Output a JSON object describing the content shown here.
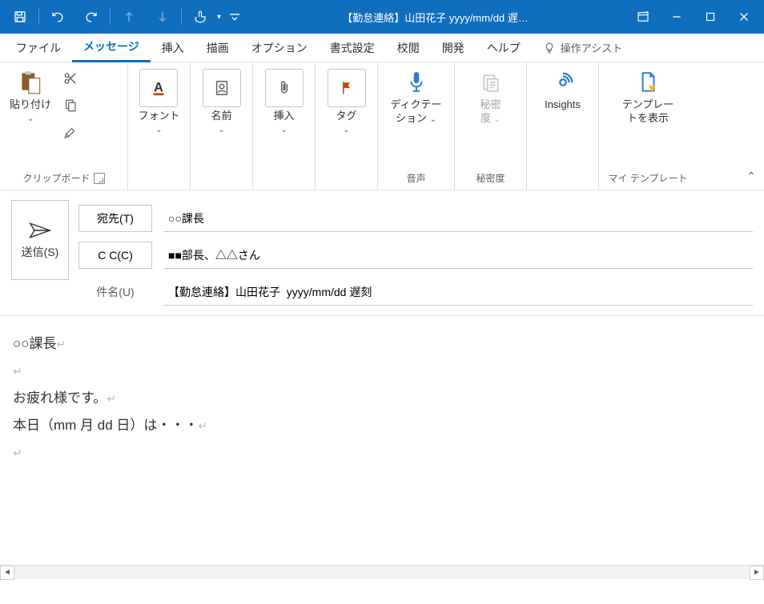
{
  "titlebar": {
    "title": "【勤怠連絡】山田花子  yyyy/mm/dd 遅…"
  },
  "tabs": {
    "file": "ファイル",
    "message": "メッセージ",
    "insert": "挿入",
    "draw": "描画",
    "options": "オプション",
    "format": "書式設定",
    "review": "校閲",
    "developer": "開発",
    "help": "ヘルプ",
    "assist": "操作アシスト"
  },
  "ribbon": {
    "clipboard": {
      "paste": "貼り付け",
      "group": "クリップボード"
    },
    "font": {
      "label": "フォント"
    },
    "name": {
      "label": "名前"
    },
    "insert": {
      "label": "挿入"
    },
    "tag": {
      "label": "タグ"
    },
    "dictation": {
      "line1": "ディクテー",
      "line2": "ション",
      "group": "音声"
    },
    "sensitivity": {
      "line1": "秘密",
      "line2": "度",
      "group": "秘密度"
    },
    "insights": {
      "label": "Insights"
    },
    "template": {
      "line1": "テンプレー",
      "line2": "トを表示",
      "group": "マイ テンプレート"
    }
  },
  "fields": {
    "send": "送信(S)",
    "to_btn": "宛先(T)",
    "to_value": "○○課長",
    "cc_btn": "C C(C)",
    "cc_value": "■■部長、△△さん",
    "subject_label": "件名(U)",
    "subject_value": "【勤怠連絡】山田花子  yyyy/mm/dd 遅刻"
  },
  "body": {
    "line1": "○○課長",
    "line2": "お疲れ様です。",
    "line3": "本日（mm 月 dd 日）は・・・"
  }
}
